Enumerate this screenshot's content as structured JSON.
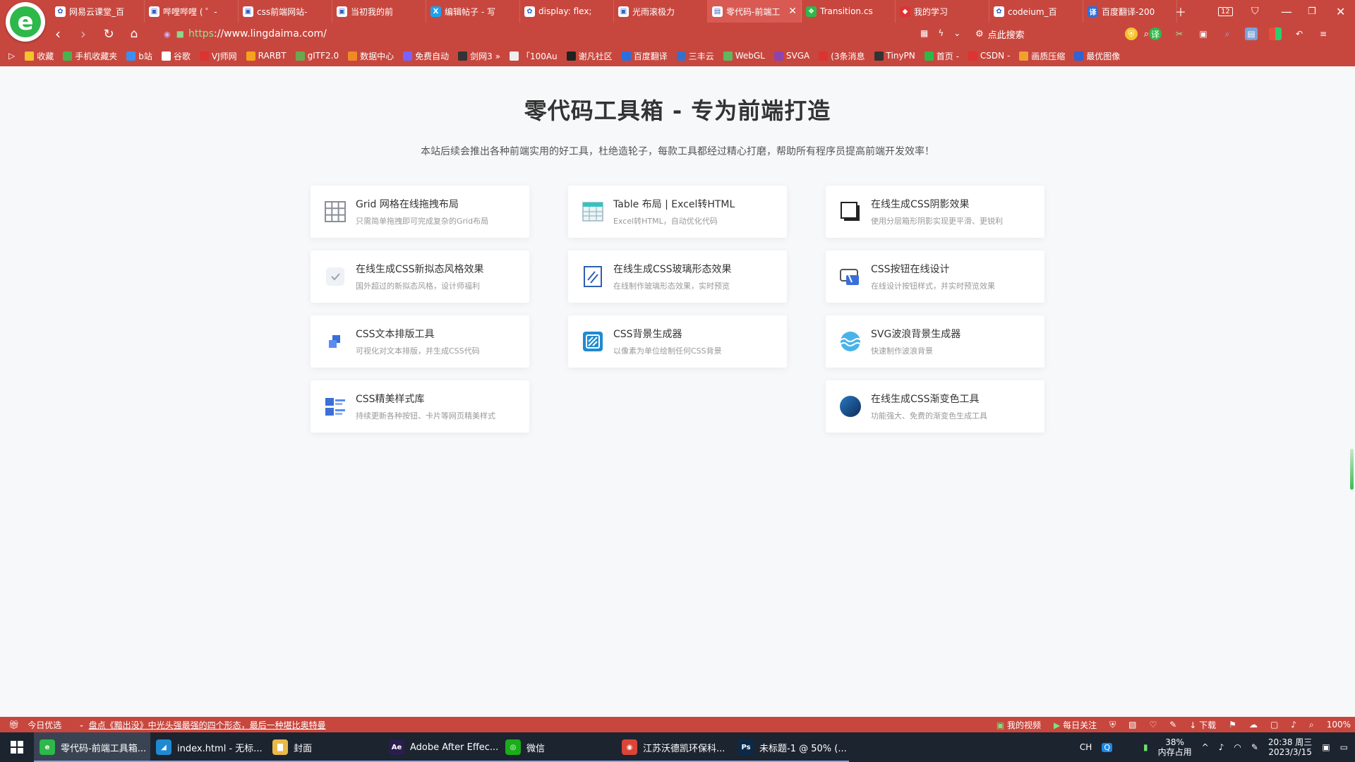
{
  "browser": {
    "tabs": [
      {
        "label": "网易云课堂_百",
        "icon": "gear-icon",
        "active": false
      },
      {
        "label": "哔哩哔哩 ( ゜-",
        "icon": "tv-icon",
        "active": false
      },
      {
        "label": "css前端网站-",
        "icon": "tv-icon",
        "active": false
      },
      {
        "label": "当初我的前",
        "icon": "tv-icon",
        "active": false
      },
      {
        "label": "编辑帖子 - 写",
        "icon": "x-icon",
        "active": false
      },
      {
        "label": "display: flex;",
        "icon": "paw-icon",
        "active": false
      },
      {
        "label": "光雨滚极力",
        "icon": "tv-icon",
        "active": false
      },
      {
        "label": "零代码-前端工",
        "icon": "page-icon",
        "active": true
      },
      {
        "label": "Transition.cs",
        "icon": "leaf-icon",
        "active": false
      },
      {
        "label": "我的学习",
        "icon": "bookmark-icon",
        "active": false
      },
      {
        "label": "codeium_百",
        "icon": "paw-icon",
        "active": false
      },
      {
        "label": "百度翻译-200",
        "icon": "translate-icon",
        "active": false
      }
    ],
    "tab_count": "12",
    "url_scheme": "https",
    "url_rest": "://www.lingdaima.com/",
    "search_placeholder": "点此搜索",
    "bookmarks": [
      {
        "label": "收藏",
        "color": "#f5c32c"
      },
      {
        "label": "手机收藏夹",
        "color": "#49b24f"
      },
      {
        "label": "b站",
        "color": "#3b8ff0"
      },
      {
        "label": "谷歌",
        "color": "#ffffff"
      },
      {
        "label": "VJ师网",
        "color": "#d33"
      },
      {
        "label": "RARBT",
        "color": "#f6a21d"
      },
      {
        "label": "gITF2.0",
        "color": "#6aa84f"
      },
      {
        "label": "数据中心",
        "color": "#f08a24"
      },
      {
        "label": "免费自动",
        "color": "#7b61ff"
      },
      {
        "label": "剑网3 »",
        "color": "#333"
      },
      {
        "label": "「100Au",
        "color": "#eee"
      },
      {
        "label": "谢凡社区",
        "color": "#222"
      },
      {
        "label": "百度翻译",
        "color": "#2a6fe0"
      },
      {
        "label": "三丰云",
        "color": "#3a6ec8"
      },
      {
        "label": "WebGL",
        "color": "#5fb85f"
      },
      {
        "label": "SVGA",
        "color": "#8e44ad"
      },
      {
        "label": "(3条消息",
        "color": "#d33"
      },
      {
        "label": "TinyPN",
        "color": "#333"
      },
      {
        "label": "首页 -",
        "color": "#2db84a"
      },
      {
        "label": "CSDN -",
        "color": "#d33"
      },
      {
        "label": "画质压缩",
        "color": "#f0a030"
      },
      {
        "label": "最优图像",
        "color": "#2f63d6"
      }
    ]
  },
  "page": {
    "title": "零代码工具箱 - 专为前端打造",
    "subtitle": "本站后续会推出各种前端实用的好工具，杜绝造轮子，每款工具都经过精心打磨，帮助所有程序员提高前端开发效率！",
    "tools": [
      {
        "title": "Grid 网格在线拖拽布局",
        "desc": "只需简单拖拽即可完成复杂的Grid布局",
        "icon": "grid-icon"
      },
      {
        "title": "Table 布局 | Excel转HTML",
        "desc": "Excel转HTML，自动优化代码",
        "icon": "table-icon"
      },
      {
        "title": "在线生成CSS阴影效果",
        "desc": "使用分层箱形阴影实现更平滑、更锐利",
        "icon": "shadow-icon"
      },
      {
        "title": "在线生成CSS新拟态风格效果",
        "desc": "国外超过的新拟态风格，设计师福利",
        "icon": "neumorphism-icon"
      },
      {
        "title": "在线生成CSS玻璃形态效果",
        "desc": "在线制作玻璃形态效果，实时预览",
        "icon": "glass-icon"
      },
      {
        "title": "CSS按钮在线设计",
        "desc": "在线设计按钮样式，并实时预览效果",
        "icon": "button-design-icon"
      },
      {
        "title": "CSS文本排版工具",
        "desc": "可视化对文本排版，并生成CSS代码",
        "icon": "text-layout-icon"
      },
      {
        "title": "CSS背景生成器",
        "desc": "以像素为单位绘制任何CSS背景",
        "icon": "background-icon"
      },
      {
        "title": "SVG波浪背景生成器",
        "desc": "快速制作波浪背景",
        "icon": "wave-icon"
      },
      {
        "title": "CSS精美样式库",
        "desc": "持续更新各种按钮、卡片等网页精美样式",
        "icon": "style-library-icon"
      },
      null,
      {
        "title": "在线生成CSS渐变色工具",
        "desc": "功能强大、免费的渐变色生成工具",
        "icon": "gradient-icon"
      }
    ]
  },
  "statusbar": {
    "today": "今日优选",
    "news": "盘点《黯出没》中光头强最强的四个形态，最后一种堪比奥特曼",
    "my_video": "我的视频",
    "daily_follow": "每日关注",
    "download": "下载",
    "zoom": "100%"
  },
  "taskbar": {
    "apps": [
      {
        "label": "零代码-前端工具箱...",
        "icon": "browser-icon",
        "color": "#2db84a",
        "glyph": "e",
        "active": true
      },
      {
        "label": "index.html - 无标...",
        "icon": "vscode-icon",
        "color": "#1f8ad2",
        "glyph": "◢",
        "active": false
      },
      {
        "label": "封面",
        "icon": "folder-icon",
        "color": "#e9b949",
        "glyph": "▇",
        "active": false
      },
      {
        "label": "Adobe After Effec...",
        "icon": "after-effects-icon",
        "color": "#2b1d4e",
        "glyph": "Ae",
        "active": false
      },
      {
        "label": "微信",
        "icon": "wechat-icon",
        "color": "#1aad19",
        "glyph": "◎",
        "active": false
      },
      {
        "label": "江苏沃德凯环保科...",
        "icon": "chrome-icon",
        "color": "#db4437",
        "glyph": "◉",
        "active": false
      },
      {
        "label": "未标题-1 @ 50% (...",
        "icon": "photoshop-icon",
        "color": "#0b2a4a",
        "glyph": "Ps",
        "active": false
      }
    ],
    "ime": "CH",
    "memory_pct": "38%",
    "memory_label": "内存占用",
    "time": "20:38 周三",
    "date": "2023/3/15"
  }
}
